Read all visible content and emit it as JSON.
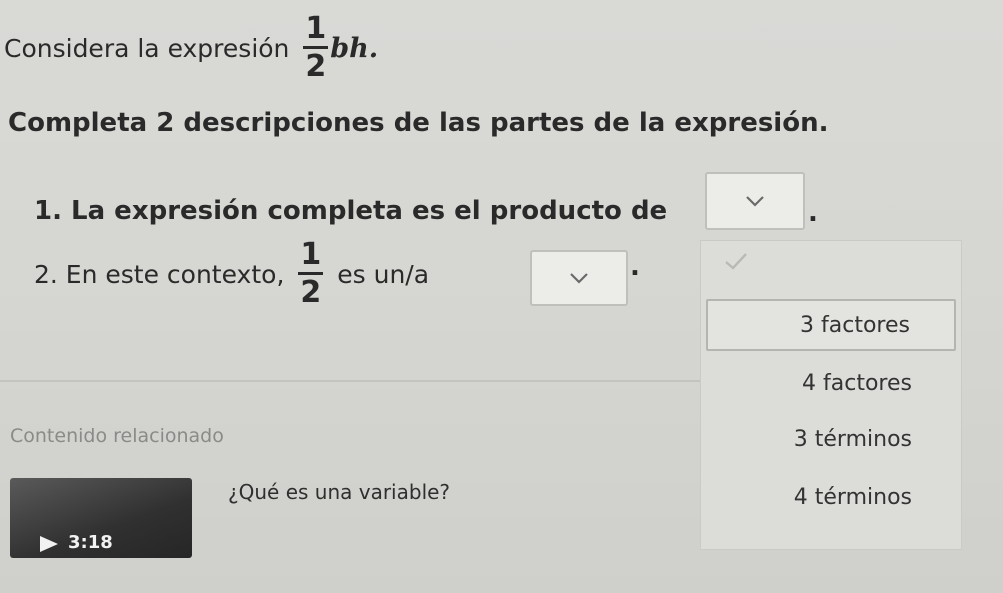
{
  "question": {
    "intro": "Considera la expresión",
    "expression": {
      "numerator": "1",
      "denominator": "2",
      "variables": "bh."
    },
    "instruction": "Completa 2 descripciones de las partes de la expresión."
  },
  "statements": [
    {
      "text": "1. La expresión completa es el producto de",
      "suffix": ".",
      "dropdown": {
        "value": ""
      }
    },
    {
      "text_before": "2. En este contexto,",
      "fraction": {
        "numerator": "1",
        "denominator": "2"
      },
      "text_after": "es un/a",
      "suffix": ".",
      "dropdown": {
        "value": ""
      }
    }
  ],
  "dropdown_menu": {
    "options": [
      "3 factores",
      "4 factores",
      "3 términos",
      "4 términos"
    ],
    "highlighted_index": 0
  },
  "related": {
    "heading": "Contenido relacionado",
    "video": {
      "duration": "3:18",
      "title": "¿Qué es una variable?"
    }
  },
  "icons": {
    "dropdown": "chevron-down-icon",
    "menu_check": "check-icon",
    "video": "play-icon"
  },
  "colors": {
    "background": "#d6d6d2",
    "text": "#2a2a2a",
    "muted_text": "#8a8a88"
  }
}
